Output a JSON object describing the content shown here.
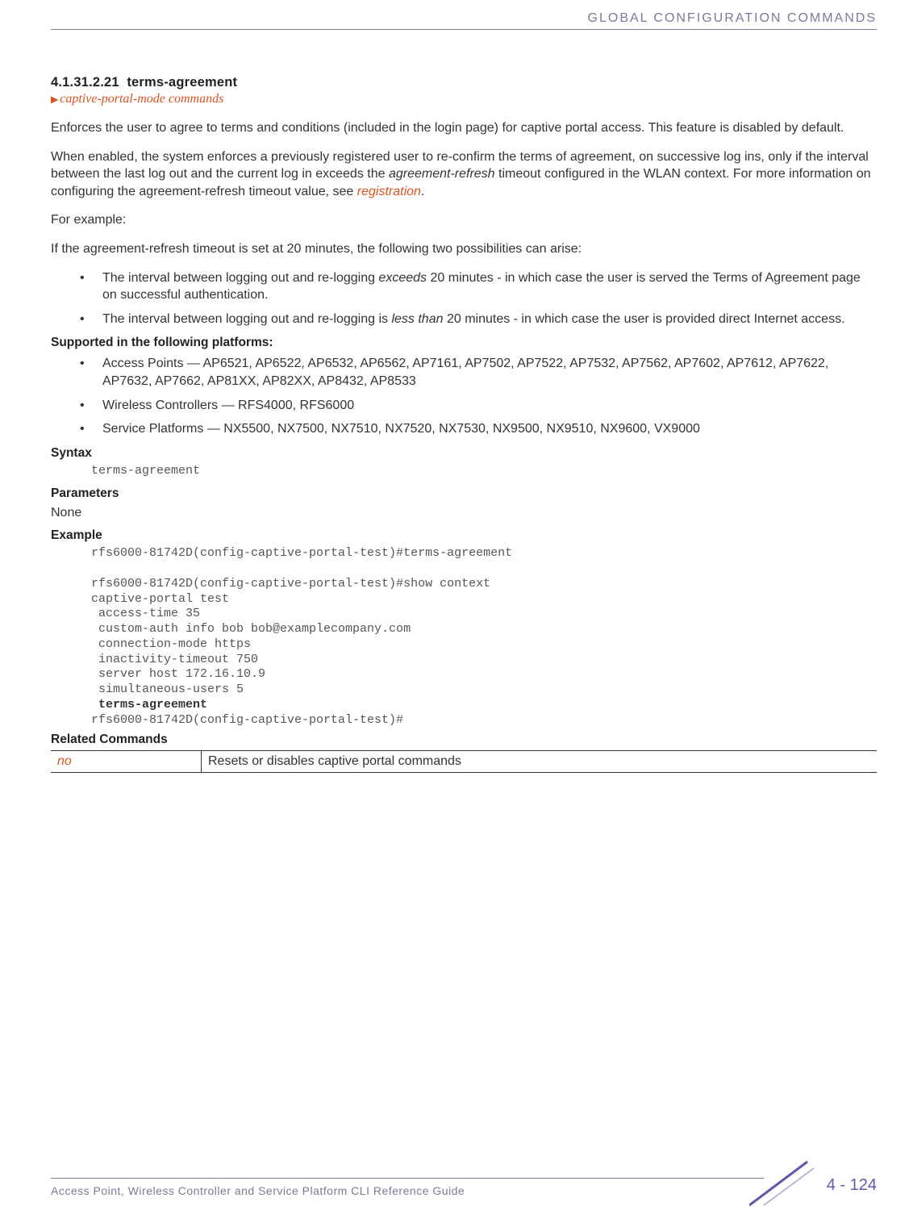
{
  "header": {
    "title": "GLOBAL CONFIGURATION COMMANDS"
  },
  "section": {
    "number": "4.1.31.2.21",
    "title": "terms-agreement",
    "breadcrumb": "captive-portal-mode commands"
  },
  "paragraphs": {
    "p1": "Enforces the user to agree to terms and conditions (included in the login page) for captive portal access. This feature is disabled by default.",
    "p2a": "When enabled, the system enforces a previously registered user to re-confirm the terms of agreement, on successive log ins, only if the interval between the last log out and the current log in exceeds the ",
    "p2_em": "agreement-refresh",
    "p2b": " timeout configured in the WLAN context. For more information on configuring the agreement-refresh timeout value, see ",
    "p2_link": "registration",
    "p2c": ".",
    "p3": "For example:",
    "p4": "If the agreement-refresh timeout is set at 20 minutes, the following two possibilities can arise:"
  },
  "possibilities": [
    {
      "pre": "The interval between logging out and re-logging ",
      "em": "exceeds",
      "post": " 20 minutes - in which case the user is served the Terms of Agreement page on successful authentication."
    },
    {
      "pre": "The interval between logging out and re-logging is ",
      "em": "less than",
      "post": " 20 minutes - in which case the user is provided direct Internet access."
    }
  ],
  "supported": {
    "heading": "Supported in the following platforms:",
    "items": [
      "Access Points — AP6521, AP6522, AP6532, AP6562, AP7161, AP7502, AP7522, AP7532, AP7562, AP7602, AP7612, AP7622, AP7632, AP7662, AP81XX, AP82XX, AP8432, AP8533",
      "Wireless Controllers — RFS4000, RFS6000",
      "Service Platforms — NX5500, NX7500, NX7510, NX7520, NX7530, NX9500, NX9510, NX9600, VX9000"
    ]
  },
  "syntax": {
    "heading": "Syntax",
    "code": "terms-agreement"
  },
  "parameters": {
    "heading": "Parameters",
    "value": "None"
  },
  "example": {
    "heading": "Example",
    "lines_pre": "rfs6000-81742D(config-captive-portal-test)#terms-agreement\n\nrfs6000-81742D(config-captive-portal-test)#show context\ncaptive-portal test\n access-time 35\n custom-auth info bob bob@examplecompany.com\n connection-mode https\n inactivity-timeout 750\n server host 172.16.10.9\n simultaneous-users 5\n ",
    "bold_line": "terms-agreement",
    "lines_post": "\nrfs6000-81742D(config-captive-portal-test)#"
  },
  "related": {
    "heading": "Related Commands",
    "rows": [
      {
        "cmd": "no",
        "desc": "Resets or disables captive portal commands"
      }
    ]
  },
  "footer": {
    "text": "Access Point, Wireless Controller and Service Platform CLI Reference Guide",
    "page": "4 - 124"
  }
}
